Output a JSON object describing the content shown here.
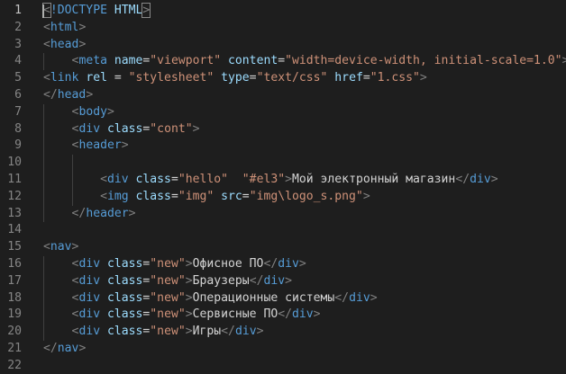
{
  "line_numbers": [
    "1",
    "2",
    "3",
    "4",
    "5",
    "6",
    "7",
    "8",
    "9",
    "10",
    "11",
    "12",
    "13",
    "14",
    "15",
    "16",
    "17",
    "18",
    "19",
    "20",
    "21",
    "22"
  ],
  "lines": [
    [
      [
        "br",
        "<"
      ],
      [
        "doc",
        "!DOCTYPE "
      ],
      [
        "dockw",
        "HTML"
      ],
      [
        "br",
        ">"
      ]
    ],
    [
      [
        "br",
        "<"
      ],
      [
        "tag",
        "html"
      ],
      [
        "br",
        ">"
      ]
    ],
    [
      [
        "br",
        "<"
      ],
      [
        "tag",
        "head"
      ],
      [
        "br",
        ">"
      ]
    ],
    [
      [
        "sp",
        "    "
      ],
      [
        "br",
        "<"
      ],
      [
        "tag",
        "meta "
      ],
      [
        "attr",
        "name"
      ],
      [
        "txt",
        "="
      ],
      [
        "str",
        "\"viewport\""
      ],
      [
        "txt",
        " "
      ],
      [
        "attr",
        "content"
      ],
      [
        "txt",
        "="
      ],
      [
        "str",
        "\"width=device-width, initial-scale=1.0\""
      ],
      [
        "br",
        ">"
      ]
    ],
    [
      [
        "br",
        "<"
      ],
      [
        "tag",
        "link "
      ],
      [
        "attr",
        "rel"
      ],
      [
        "txt",
        " = "
      ],
      [
        "str",
        "\"stylesheet\""
      ],
      [
        "txt",
        " "
      ],
      [
        "attr",
        "type"
      ],
      [
        "txt",
        "="
      ],
      [
        "str",
        "\"text/css\""
      ],
      [
        "txt",
        " "
      ],
      [
        "attr",
        "href"
      ],
      [
        "txt",
        "="
      ],
      [
        "str",
        "\"1.css\""
      ],
      [
        "br",
        ">"
      ]
    ],
    [
      [
        "br",
        "</"
      ],
      [
        "tag",
        "head"
      ],
      [
        "br",
        ">"
      ]
    ],
    [
      [
        "sp",
        "    "
      ],
      [
        "br",
        "<"
      ],
      [
        "tag",
        "body"
      ],
      [
        "br",
        ">"
      ]
    ],
    [
      [
        "sp",
        "    "
      ],
      [
        "br",
        "<"
      ],
      [
        "tag",
        "div "
      ],
      [
        "attr",
        "class"
      ],
      [
        "txt",
        "="
      ],
      [
        "str",
        "\"cont\""
      ],
      [
        "br",
        ">"
      ]
    ],
    [
      [
        "sp",
        "    "
      ],
      [
        "br",
        "<"
      ],
      [
        "tag",
        "header"
      ],
      [
        "br",
        ">"
      ]
    ],
    [],
    [
      [
        "sp",
        "        "
      ],
      [
        "br",
        "<"
      ],
      [
        "tag",
        "div "
      ],
      [
        "attr",
        "class"
      ],
      [
        "txt",
        "="
      ],
      [
        "str",
        "\"hello\""
      ],
      [
        "txt",
        "  "
      ],
      [
        "str",
        "\"#el3\""
      ],
      [
        "br",
        ">"
      ],
      [
        "txt",
        "Мой электронный магазин"
      ],
      [
        "br",
        "</"
      ],
      [
        "tag",
        "div"
      ],
      [
        "br",
        ">"
      ]
    ],
    [
      [
        "sp",
        "        "
      ],
      [
        "br",
        "<"
      ],
      [
        "tag",
        "img "
      ],
      [
        "attr",
        "class"
      ],
      [
        "txt",
        "="
      ],
      [
        "str",
        "\"img\""
      ],
      [
        "txt",
        " "
      ],
      [
        "attr",
        "src"
      ],
      [
        "txt",
        "="
      ],
      [
        "str",
        "\"img\\logo_s.png\""
      ],
      [
        "br",
        ">"
      ]
    ],
    [
      [
        "sp",
        "    "
      ],
      [
        "br",
        "</"
      ],
      [
        "tag",
        "header"
      ],
      [
        "br",
        ">"
      ]
    ],
    [],
    [
      [
        "br",
        "<"
      ],
      [
        "tag",
        "nav"
      ],
      [
        "br",
        ">"
      ]
    ],
    [
      [
        "sp",
        "    "
      ],
      [
        "br",
        "<"
      ],
      [
        "tag",
        "div "
      ],
      [
        "attr",
        "class"
      ],
      [
        "txt",
        "="
      ],
      [
        "str",
        "\"new\""
      ],
      [
        "br",
        ">"
      ],
      [
        "txt",
        "Офисное ПО"
      ],
      [
        "br",
        "</"
      ],
      [
        "tag",
        "div"
      ],
      [
        "br",
        ">"
      ]
    ],
    [
      [
        "sp",
        "    "
      ],
      [
        "br",
        "<"
      ],
      [
        "tag",
        "div "
      ],
      [
        "attr",
        "class"
      ],
      [
        "txt",
        "="
      ],
      [
        "str",
        "\"new\""
      ],
      [
        "br",
        ">"
      ],
      [
        "txt",
        "Браузеры"
      ],
      [
        "br",
        "</"
      ],
      [
        "tag",
        "div"
      ],
      [
        "br",
        ">"
      ]
    ],
    [
      [
        "sp",
        "    "
      ],
      [
        "br",
        "<"
      ],
      [
        "tag",
        "div "
      ],
      [
        "attr",
        "class"
      ],
      [
        "txt",
        "="
      ],
      [
        "str",
        "\"new\""
      ],
      [
        "br",
        ">"
      ],
      [
        "txt",
        "Операционные системы"
      ],
      [
        "br",
        "</"
      ],
      [
        "tag",
        "div"
      ],
      [
        "br",
        ">"
      ]
    ],
    [
      [
        "sp",
        "    "
      ],
      [
        "br",
        "<"
      ],
      [
        "tag",
        "div "
      ],
      [
        "attr",
        "class"
      ],
      [
        "txt",
        "="
      ],
      [
        "str",
        "\"new\""
      ],
      [
        "br",
        ">"
      ],
      [
        "txt",
        "Сервисные ПО"
      ],
      [
        "br",
        "</"
      ],
      [
        "tag",
        "div"
      ],
      [
        "br",
        ">"
      ]
    ],
    [
      [
        "sp",
        "    "
      ],
      [
        "br",
        "<"
      ],
      [
        "tag",
        "div "
      ],
      [
        "attr",
        "class"
      ],
      [
        "txt",
        "="
      ],
      [
        "str",
        "\"new\""
      ],
      [
        "br",
        ">"
      ],
      [
        "txt",
        "Игры"
      ],
      [
        "br",
        "</"
      ],
      [
        "tag",
        "div"
      ],
      [
        "br",
        ">"
      ]
    ],
    [
      [
        "br",
        "</"
      ],
      [
        "tag",
        "nav"
      ],
      [
        "br",
        ">"
      ]
    ],
    []
  ]
}
